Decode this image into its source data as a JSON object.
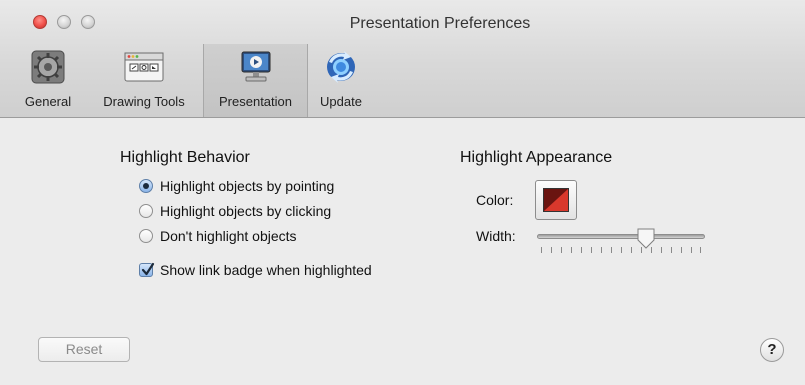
{
  "window": {
    "title": "Presentation Preferences"
  },
  "toolbar": {
    "items": [
      {
        "label": "General",
        "icon": "gear-icon"
      },
      {
        "label": "Drawing Tools",
        "icon": "drawing-tools-icon"
      },
      {
        "label": "Presentation",
        "icon": "presentation-icon",
        "selected": true
      },
      {
        "label": "Update",
        "icon": "update-icon"
      }
    ]
  },
  "behavior": {
    "title": "Highlight Behavior",
    "options": [
      {
        "label": "Highlight objects by pointing",
        "selected": true
      },
      {
        "label": "Highlight objects by clicking",
        "selected": false
      },
      {
        "label": "Don't highlight objects",
        "selected": false
      }
    ],
    "show_link_badge": {
      "label": "Show link badge when highlighted",
      "checked": true
    }
  },
  "appearance": {
    "title": "Highlight Appearance",
    "color_label": "Color:",
    "color_value": "#d9382c",
    "width_label": "Width:",
    "width_fraction": 0.65
  },
  "footer": {
    "reset_label": "Reset",
    "help_label": "?"
  }
}
